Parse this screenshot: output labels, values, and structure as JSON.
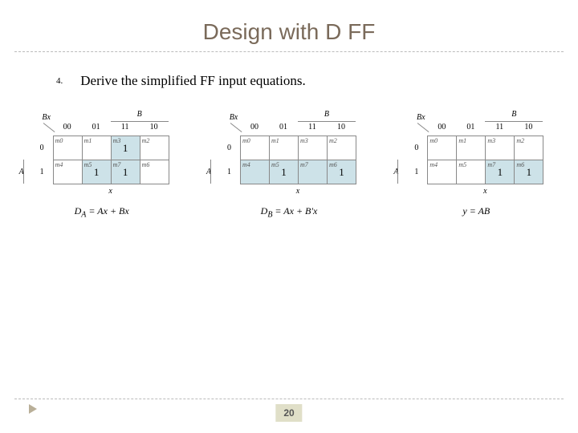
{
  "title": "Design with D FF",
  "step_number": "4.",
  "step_text": "Derive the simplified FF input equations.",
  "page_number": "20",
  "common": {
    "corner_label": "Bx",
    "top_var": "B",
    "left_var": "A",
    "bottom_var": "x",
    "col_headers": [
      "00",
      "01",
      "11",
      "10"
    ],
    "row_headers": [
      "0",
      "1"
    ],
    "minterms_row0": [
      "m0",
      "m1",
      "m3",
      "m2"
    ],
    "minterms_row1": [
      "m4",
      "m5",
      "m7",
      "m6"
    ]
  },
  "kmaps": [
    {
      "ones": [
        [
          0,
          2
        ],
        [
          1,
          1
        ],
        [
          1,
          2
        ]
      ],
      "fill_cells": [
        [
          0,
          0
        ],
        [
          0,
          1
        ],
        [
          0,
          2
        ],
        [
          0,
          3
        ],
        [
          1,
          0
        ],
        [
          1,
          1
        ],
        [
          1,
          2
        ],
        [
          1,
          3
        ]
      ],
      "highlight": [
        [
          1,
          1
        ],
        [
          1,
          2
        ],
        [
          0,
          2
        ]
      ],
      "equation": "D_A = Ax + Bx"
    },
    {
      "ones": [
        [
          1,
          1
        ],
        [
          1,
          3
        ]
      ],
      "highlight": [
        [
          1,
          0
        ],
        [
          1,
          1
        ],
        [
          1,
          2
        ],
        [
          1,
          3
        ]
      ],
      "equation": "D_B = Ax + B'x"
    },
    {
      "ones": [
        [
          1,
          2
        ],
        [
          1,
          3
        ]
      ],
      "highlight": [
        [
          1,
          2
        ],
        [
          1,
          3
        ]
      ],
      "equation": "y = AB"
    }
  ]
}
